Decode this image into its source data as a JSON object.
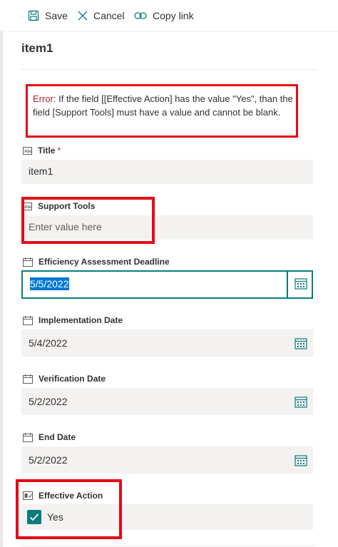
{
  "toolbar": {
    "save_label": "Save",
    "cancel_label": "Cancel",
    "copy_link_label": "Copy link"
  },
  "item_title": "item1",
  "error": {
    "prefix": "Error:",
    "message": " If the field [[Effective Action] has the value \"Yes\", than the field [Support Tools] must have a value and cannot be blank."
  },
  "fields": {
    "title": {
      "label": "Title",
      "required_marker": "*",
      "value": "item1",
      "icon": "text-field-icon"
    },
    "support_tools": {
      "label": "Support Tools",
      "placeholder": "Enter value here",
      "icon": "text-field-icon"
    },
    "efficiency_deadline": {
      "label": "Efficiency Assessment Deadline",
      "value": "5/5/2022",
      "icon": "calendar-icon"
    },
    "implementation_date": {
      "label": "Implementation Date",
      "value": "5/4/2022",
      "icon": "calendar-icon"
    },
    "verification_date": {
      "label": "Verification Date",
      "value": "5/2/2022",
      "icon": "calendar-icon"
    },
    "end_date": {
      "label": "End Date",
      "value": "5/2/2022",
      "icon": "calendar-icon"
    },
    "effective_action": {
      "label": "Effective Action",
      "value": "Yes",
      "checked": true,
      "icon": "yes-no-icon"
    }
  },
  "colors": {
    "accent": "#0b7b7c",
    "annotation_red": "#e50914",
    "error_text": "#a4262c",
    "field_bg": "#f3f2f1"
  }
}
